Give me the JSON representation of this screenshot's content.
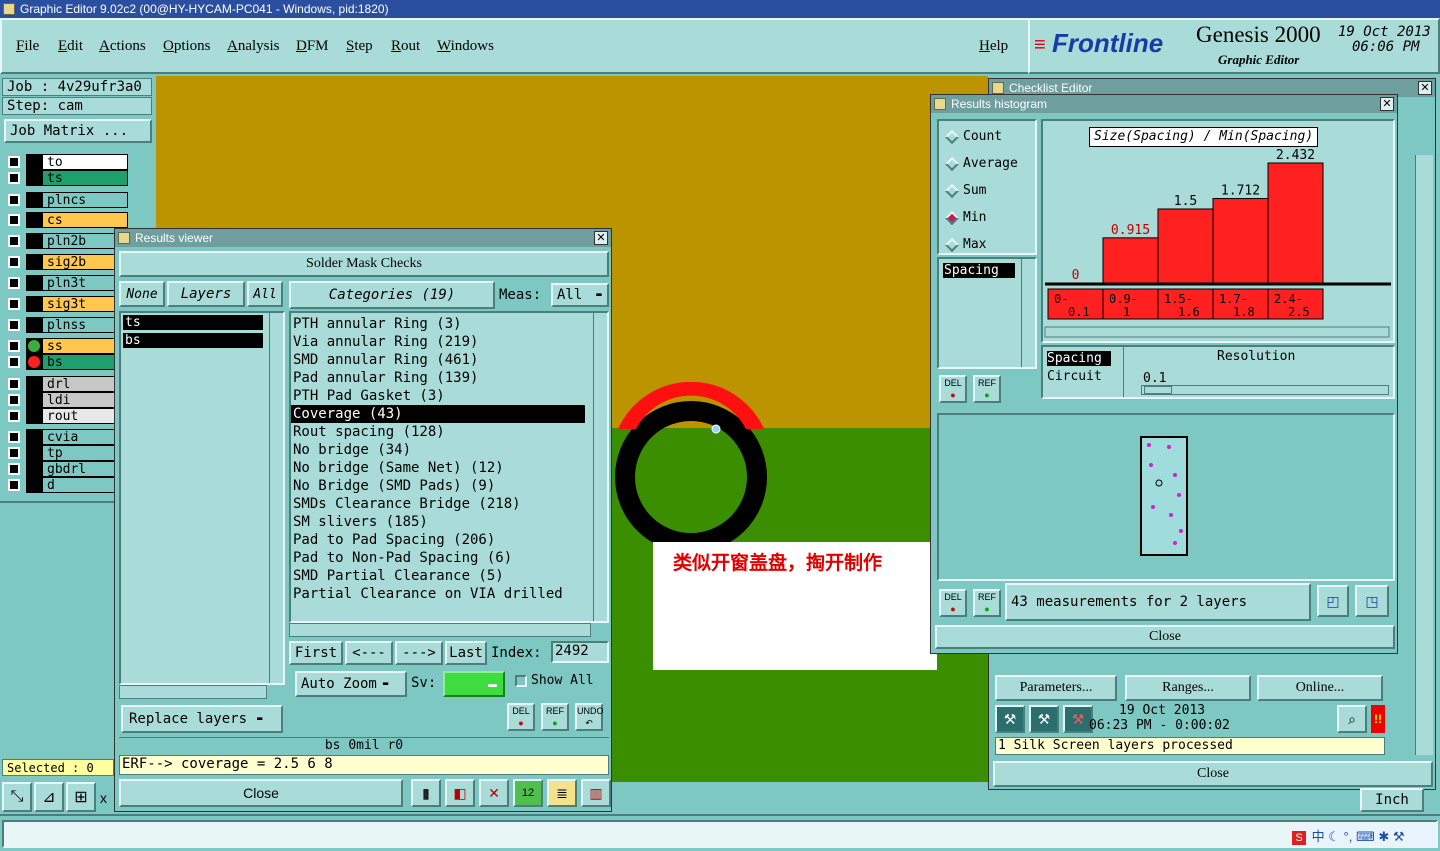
{
  "app": {
    "title": "Graphic Editor 9.02c2 (00@HY-HYCAM-PC041 - Windows, pid:1820)"
  },
  "menu": [
    "File",
    "Edit",
    "Actions",
    "Options",
    "Analysis",
    "DFM",
    "Step",
    "Rout",
    "Windows"
  ],
  "help": "Help",
  "brand": {
    "logo": "Frontline",
    "product": "Genesis 2000",
    "subtitle": "Graphic Editor",
    "date": "19 Oct 2013",
    "time": "06:06 PM"
  },
  "job": {
    "job_label": "Job : 4v29ufr3a0",
    "step_label": "Step: cam",
    "matrix_button": "Job Matrix ..."
  },
  "layers": [
    {
      "name": "to",
      "bg": "#ffffff"
    },
    {
      "name": "ts",
      "bg": "#1f9e6e"
    },
    {
      "name": "plncs",
      "bg": "#7ec8c4"
    },
    {
      "name": "cs",
      "bg": "#ffc74d"
    },
    {
      "name": "pln2b",
      "bg": "#7ec8c4"
    },
    {
      "name": "sig2b",
      "bg": "#ffc74d"
    },
    {
      "name": "pln3t",
      "bg": "#7ec8c4"
    },
    {
      "name": "sig3t",
      "bg": "#ffc74d"
    },
    {
      "name": "plnss",
      "bg": "#7ec8c4"
    },
    {
      "name": "ss",
      "bg": "#ffc74d"
    },
    {
      "name": "bs",
      "bg": "#1f9e6e"
    },
    {
      "name": "drl",
      "bg": "#c7c7c7"
    },
    {
      "name": "ldi",
      "bg": "#c7c7c7"
    },
    {
      "name": "rout",
      "bg": "#e8e8e8"
    },
    {
      "name": "cvia",
      "bg": "#7ec8c4"
    },
    {
      "name": "tp",
      "bg": "#7ec8c4"
    },
    {
      "name": "gbdrl",
      "bg": "#7ec8c4"
    },
    {
      "name": "d",
      "bg": "#7ec8c4"
    }
  ],
  "status": {
    "selected": "Selected : 0",
    "x_label": "x",
    "units": "Inch"
  },
  "annotation": "类似开窗盖盘，掏开制作",
  "results_viewer": {
    "title": "Results viewer",
    "heading": "Solder Mask Checks",
    "none_btn": "None",
    "layers_btn": "Layers",
    "all_btn": "All",
    "categories_btn": "Categories (19)",
    "meas_label": "Meas:",
    "meas_value": "All",
    "layer_list": [
      "ts",
      "bs"
    ],
    "categories": [
      "PTH annular Ring (3)",
      "Via annular Ring (219)",
      "SMD annular Ring (461)",
      "Pad annular Ring (139)",
      "PTH Pad Gasket (3)",
      "Coverage (43)",
      "Rout spacing (128)",
      "No bridge (34)",
      "No bridge (Same Net) (12)",
      "No Bridge (SMD Pads) (9)",
      "SMDs Clearance Bridge (218)",
      "SM slivers (185)",
      "Pad to Pad Spacing (206)",
      "Pad to Non-Pad Spacing (6)",
      "SMD Partial Clearance (5)",
      "Partial Clearance on VIA drilled"
    ],
    "selected_category": 5,
    "first": "First",
    "prev": "<---",
    "next": "--->",
    "last": "Last",
    "index_label": "Index:",
    "index_value": "2492",
    "auto_zoom": "Auto Zoom",
    "sv_label": "Sv:",
    "show_all": "Show All",
    "replace_layers": "Replace layers",
    "del": "DEL",
    "ref": "REF",
    "undo": "UNDO",
    "info_line": "bs 0mil r0",
    "erf_line": "ERF--> coverage = 2.5 6 8",
    "close": "Close"
  },
  "histogram": {
    "title": "Results histogram",
    "radios": [
      {
        "label": "Count",
        "on": false
      },
      {
        "label": "Average",
        "on": false
      },
      {
        "label": "Sum",
        "on": false
      },
      {
        "label": "Min",
        "on": true
      },
      {
        "label": "Max",
        "on": false
      }
    ],
    "metric_list": [
      "Spacing"
    ],
    "chart_title": "Size(Spacing) / Min(Spacing)",
    "lower_list": [
      "Spacing",
      "Circuit"
    ],
    "resolution_label": "Resolution",
    "resolution_value": "0.1",
    "measurements": "43 measurements for 2 layers",
    "close": "Close"
  },
  "chart_data": {
    "type": "bar",
    "title": "Size(Spacing) / Min(Spacing)",
    "categories": [
      "0-0.1",
      "0.9-1",
      "1.5-1.6",
      "1.7-1.8",
      "2.4-2.5"
    ],
    "category_lines": [
      [
        "0-",
        "0.1"
      ],
      [
        "0.9-",
        "1"
      ],
      [
        "1.5-",
        "1.6"
      ],
      [
        "1.7-",
        "1.8"
      ],
      [
        "2.4-",
        "2.5"
      ]
    ],
    "values": [
      0,
      0.915,
      1.5,
      1.712,
      2.432
    ],
    "value_labels": [
      "0",
      "0.915",
      "1.5",
      "1.712",
      "2.432"
    ],
    "ylim": [
      0,
      2.432
    ],
    "colors": {
      "bar": "#ff2020",
      "first_label": "#c00000",
      "second_label": "#c00000"
    }
  },
  "checklist": {
    "title": "Checklist Editor",
    "parameters": "Parameters...",
    "ranges": "Ranges...",
    "online": "Online...",
    "date": "19 Oct 2013",
    "time": "06:23 PM - 0:00:02",
    "log": "1 Silk Screen layers processed",
    "close": "Close"
  },
  "tray": {
    "ime": "中"
  }
}
